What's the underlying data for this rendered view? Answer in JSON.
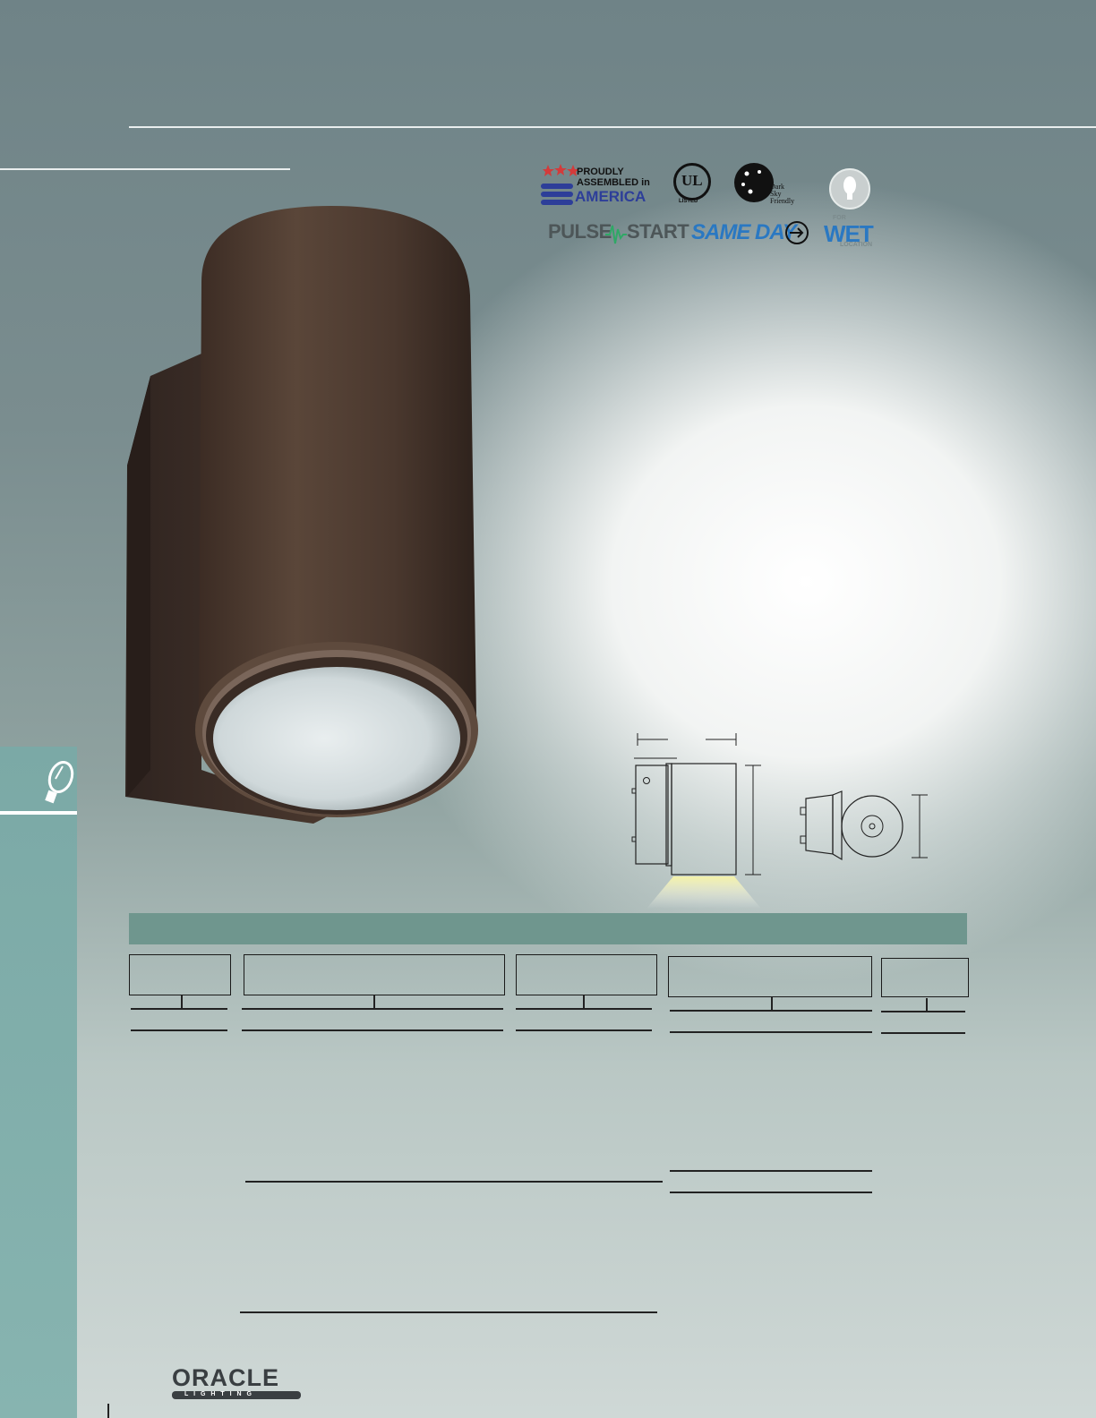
{
  "logos": {
    "america_line1": "PROUDLY",
    "america_line2": "ASSEMBLED in",
    "america_line3": "AMERICA",
    "ul_mark": "UL",
    "ul_caption": "LISTED",
    "darksky_line1": "Dark",
    "darksky_line2": "Sky",
    "darksky_line3": "Friendly",
    "pulsestart_a": "PULSE",
    "pulsestart_b": "START",
    "sameday": "SAME DAY",
    "wet_top": "FOR",
    "wet_main": "WET",
    "wet_bottom": "LOCATION",
    "oracle_main": "ORACLE",
    "oracle_sub": "L I G H T I N G"
  },
  "colors": {
    "background_top": "#6f8387",
    "sidebar": "#7ba9a6",
    "green_bar": "#6f968e",
    "fixture_bronze": "#4d3a30",
    "america_blue": "#2d3e99",
    "america_red": "#d33b3b",
    "sameday_blue": "#2a78c2"
  },
  "icons": [
    "star-icon",
    "bulb-icon",
    "arrow-right-icon",
    "pulse-wave-icon"
  ]
}
